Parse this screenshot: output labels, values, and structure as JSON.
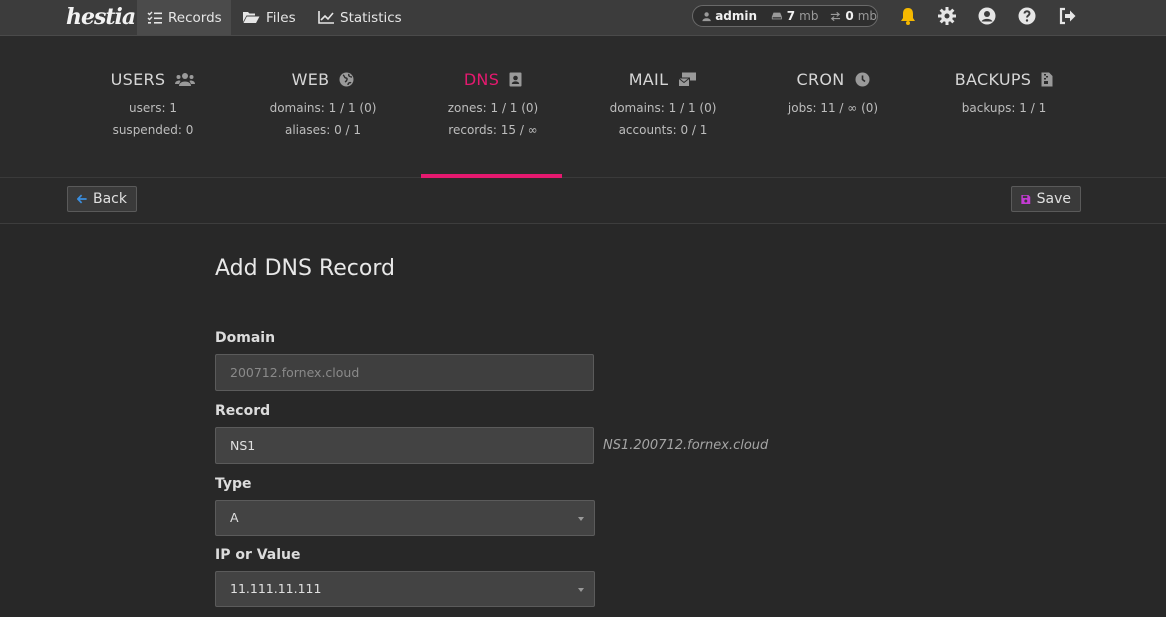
{
  "nav": {
    "logo": "hestia",
    "records": "Records",
    "files": "Files",
    "statistics": "Statistics"
  },
  "user": {
    "name": "admin",
    "disk_value": "7",
    "disk_unit": "mb",
    "bw_value": "0",
    "bw_unit": "mb"
  },
  "stats": [
    {
      "title": "USERS",
      "line1": "users: 1",
      "line2": "suspended: 0"
    },
    {
      "title": "WEB",
      "line1": "domains: 1 / 1 (0)",
      "line2": "aliases: 0 / 1"
    },
    {
      "title": "DNS",
      "line1": "zones: 1 / 1 (0)",
      "line2": "records: 15 / ∞"
    },
    {
      "title": "MAIL",
      "line1": "domains: 1 / 1 (0)",
      "line2": "accounts: 0 / 1"
    },
    {
      "title": "CRON",
      "line1": "jobs: 11 / ∞ (0)",
      "line2": ""
    },
    {
      "title": "BACKUPS",
      "line1": "backups: 1 / 1",
      "line2": ""
    }
  ],
  "toolbar": {
    "back_label": "Back",
    "save_label": "Save"
  },
  "form": {
    "title": "Add DNS Record",
    "domain_label": "Domain",
    "domain_value": "200712.fornex.cloud",
    "record_label": "Record",
    "record_value": "NS1",
    "record_hint": "NS1.200712.fornex.cloud",
    "type_label": "Type",
    "type_value": "A",
    "value_label": "IP or Value",
    "value_value": "11.111.11.111"
  },
  "colors": {
    "accent": "#e5196f",
    "bell": "#f5b800",
    "save_icon": "#c23bd1",
    "back_icon": "#3a8fe0"
  }
}
